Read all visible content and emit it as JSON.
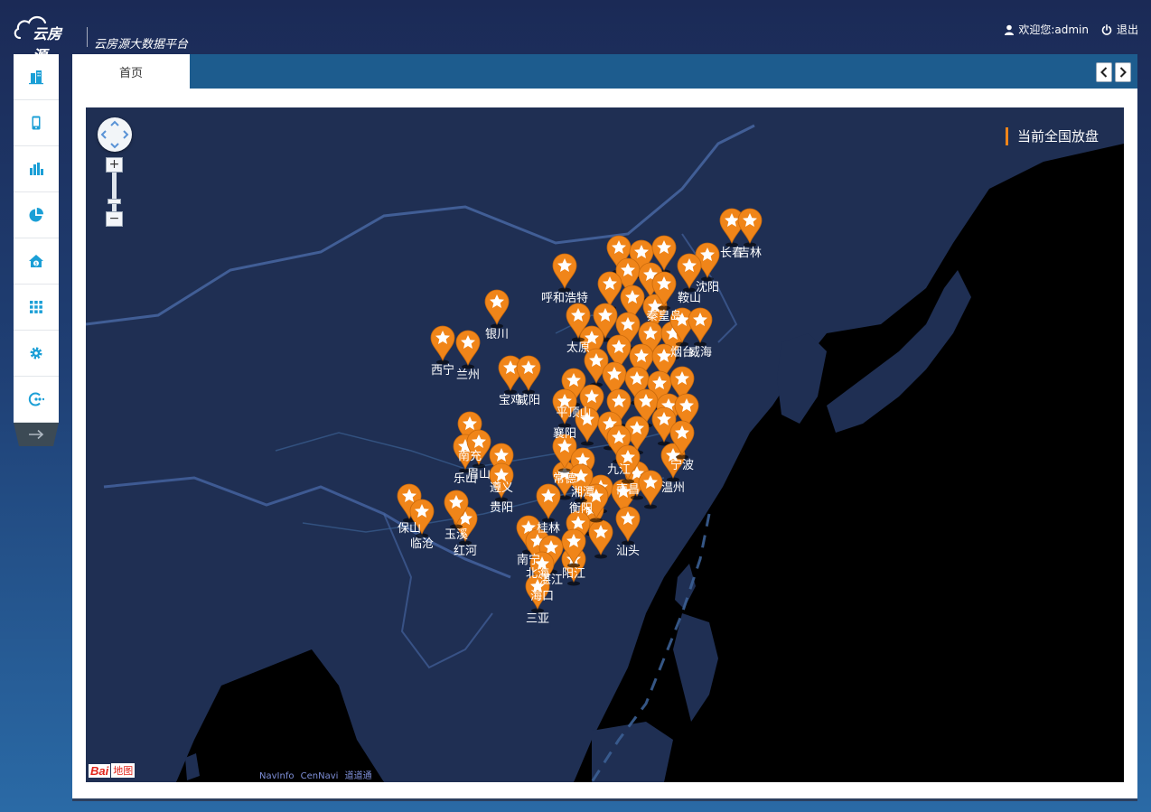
{
  "header": {
    "brand": "云房源",
    "subtitle": "云房源大数据平台",
    "welcome": "欢迎您:admin",
    "logout": "退出"
  },
  "sidebar": {
    "items": [
      {
        "icon": "building-icon"
      },
      {
        "icon": "phone-icon"
      },
      {
        "icon": "bar-chart-icon"
      },
      {
        "icon": "pie-chart-icon"
      },
      {
        "icon": "house-money-icon"
      },
      {
        "icon": "grid-icon"
      },
      {
        "icon": "gear-icon"
      },
      {
        "icon": "network-icon"
      }
    ],
    "toggle_icon": "arrow-right-icon"
  },
  "tabs": {
    "home": "首页"
  },
  "map": {
    "title": "当前全国放盘",
    "accent": "#f08519",
    "attribution": [
      "NavInfo",
      "CenNavi",
      "道道通"
    ],
    "logo_text": "Bai",
    "logo_suffix": "地图",
    "zoom_in": "+",
    "zoom_out": "−",
    "cities": [
      "长春",
      "吉林",
      "沈阳",
      "鞍山",
      "呼和浩特",
      "秦皇岛",
      "烟台",
      "威海",
      "银川",
      "西宁",
      "兰州",
      "宝鸡",
      "咸阳",
      "太原",
      "平顶山",
      "襄阳",
      "南充",
      "乐山",
      "眉山",
      "遵义",
      "贵阳",
      "常德",
      "湘潭",
      "衡阳",
      "九江",
      "南昌",
      "温州",
      "宁波",
      "汕头",
      "桂林",
      "南宁",
      "北海",
      "湛江",
      "阳江",
      "海口",
      "三亚",
      "保山",
      "临沧",
      "红河",
      "玉溪"
    ]
  }
}
